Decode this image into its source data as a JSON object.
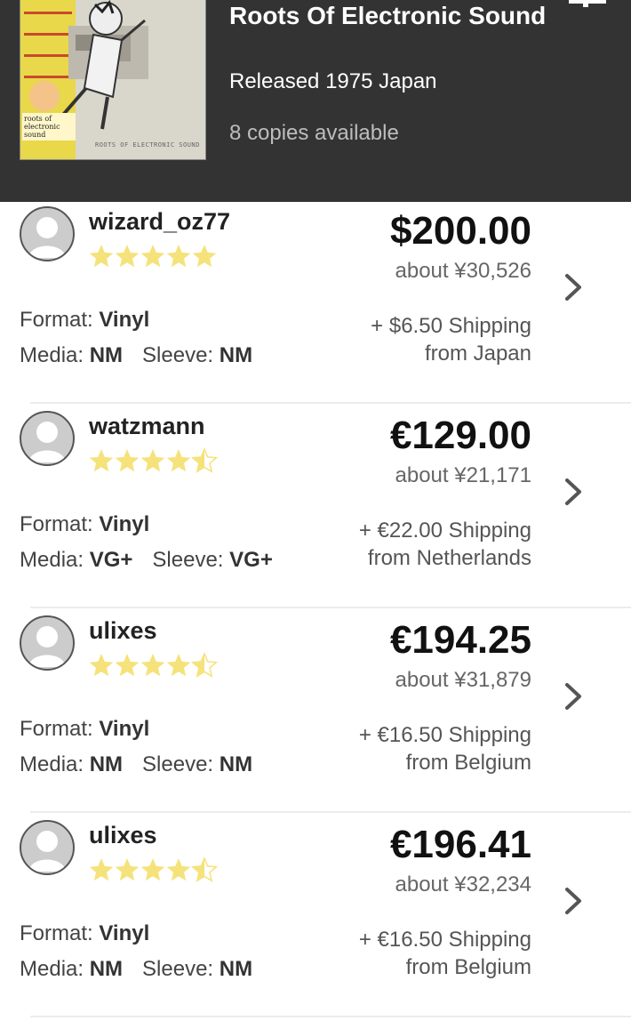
{
  "header": {
    "title": "Roots Of Electronic Sound",
    "released": "Released 1975 Japan",
    "copies": "8 copies available",
    "cover_text": "roots of electronic sound",
    "cover_bottom_text": "ROOTS OF ELECTRONIC SOUND"
  },
  "labels": {
    "format": "Format:",
    "media": "Media:",
    "sleeve": "Sleeve:"
  },
  "listings": [
    {
      "seller": "wizard_oz77",
      "rating_stars": 5,
      "price": "$200.00",
      "approx": "about ¥30,526",
      "shipping": "+ $6.50 Shipping",
      "origin": "from Japan",
      "format": "Vinyl",
      "media": "NM",
      "sleeve": "NM"
    },
    {
      "seller": "watzmann",
      "rating_stars": 4.5,
      "price": "€129.00",
      "approx": "about ¥21,171",
      "shipping": "+ €22.00 Shipping",
      "origin": "from Netherlands",
      "format": "Vinyl",
      "media": "VG+",
      "sleeve": "VG+"
    },
    {
      "seller": "ulixes",
      "rating_stars": 4.5,
      "price": "€194.25",
      "approx": "about ¥31,879",
      "shipping": "+ €16.50 Shipping",
      "origin": "from Belgium",
      "format": "Vinyl",
      "media": "NM",
      "sleeve": "NM"
    },
    {
      "seller": "ulixes",
      "rating_stars": 4.5,
      "price": "€196.41",
      "approx": "about ¥32,234",
      "shipping": "+ €16.50 Shipping",
      "origin": "from Belgium",
      "format": "Vinyl",
      "media": "NM",
      "sleeve": "NM"
    }
  ],
  "colors": {
    "header_bg": "#333333",
    "star": "#f5e27a",
    "star_empty": "#ffffff"
  }
}
